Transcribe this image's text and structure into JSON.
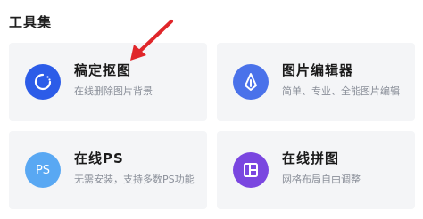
{
  "section": {
    "title": "工具集"
  },
  "tools": [
    {
      "title": "稿定抠图",
      "desc": "在线删除图片背景",
      "icon": "cutout-icon",
      "color": "#2c5ce8"
    },
    {
      "title": "图片编辑器",
      "desc": "简单、专业、全能图片编辑",
      "icon": "pen-nib-icon",
      "color": "#4a72ea"
    },
    {
      "title": "在线PS",
      "desc": "无需安装，支持多数PS功能",
      "icon": "ps-icon",
      "icon_text": "PS",
      "color": "#59a8f3"
    },
    {
      "title": "在线拼图",
      "desc": "网格布局自由调整",
      "icon": "collage-icon",
      "color": "#7a46e0"
    }
  ],
  "annotation": {
    "icon": "arrow-annotation-icon",
    "color": "#e0262a"
  }
}
